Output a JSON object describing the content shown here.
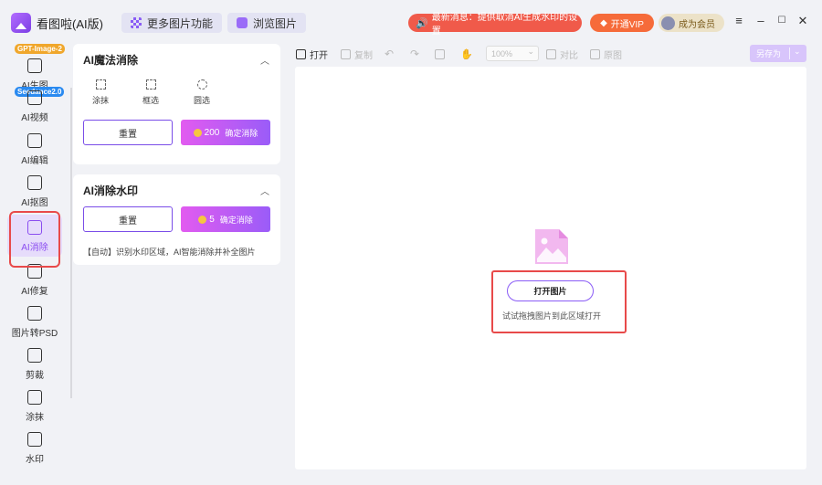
{
  "app": {
    "title": "看图啦(AI版)",
    "top_buttons": [
      {
        "label": "更多图片功能",
        "icon": "apps-grid-icon"
      },
      {
        "label": "浏览图片",
        "icon": "gallery-icon"
      }
    ],
    "news": {
      "label": "最新消息：提供取消AI生成水印的设置",
      "icon": "speaker-icon"
    },
    "vip": {
      "label": "开通VIP",
      "icon": "diamond-icon"
    },
    "member": {
      "label": "成为会员"
    },
    "window_controls": {
      "menu": "≡",
      "minimize": "–",
      "maximize": "☐",
      "close": "✕"
    }
  },
  "sidebar": {
    "tags": {
      "gpt": "GPT-Image-2",
      "seed": "Seedance2.0"
    },
    "items": [
      {
        "label": "AI生图",
        "icon": "image-gen-icon"
      },
      {
        "label": "AI视频",
        "icon": "film-icon"
      },
      {
        "label": "AI编辑",
        "icon": "ai-edit-icon"
      },
      {
        "label": "AI抠图",
        "icon": "cutout-icon"
      },
      {
        "label": "AI消除",
        "icon": "eraser-icon",
        "active": true
      },
      {
        "label": "AI修复",
        "icon": "hd-icon"
      },
      {
        "label": "图片转PSD",
        "icon": "psd-icon"
      },
      {
        "label": "剪裁",
        "icon": "crop-icon"
      },
      {
        "label": "涂抹",
        "icon": "bandage-icon"
      },
      {
        "label": "水印",
        "icon": "watermark-icon"
      }
    ]
  },
  "panel": {
    "magic_erase": {
      "title": "AI魔法消除",
      "tools": [
        {
          "label": "涂抹",
          "icon": "brush-icon"
        },
        {
          "label": "框选",
          "icon": "rect-select-icon"
        },
        {
          "label": "圆选",
          "icon": "circle-select-icon"
        }
      ],
      "reset_label": "重置",
      "confirm_cost": "200",
      "confirm_label": "确定消除"
    },
    "watermark_erase": {
      "title": "AI消除水印",
      "reset_label": "重置",
      "confirm_cost": "5",
      "confirm_label": "确定消除",
      "note": "【自动】识别水印区域，AI智能消除并补全图片"
    }
  },
  "toolbar": {
    "open": "打开",
    "copy": "复制",
    "zoom": "100%",
    "compare": "对比",
    "original": "原图",
    "save_as": "另存为"
  },
  "canvas": {
    "open_button": "打开图片",
    "drag_hint": "试试拖拽图片到此区域打开"
  },
  "colors": {
    "accent": "#8a5cf6",
    "highlight": "#e84a4a",
    "news": "#f05a4a",
    "vip": "#f66b3a"
  }
}
